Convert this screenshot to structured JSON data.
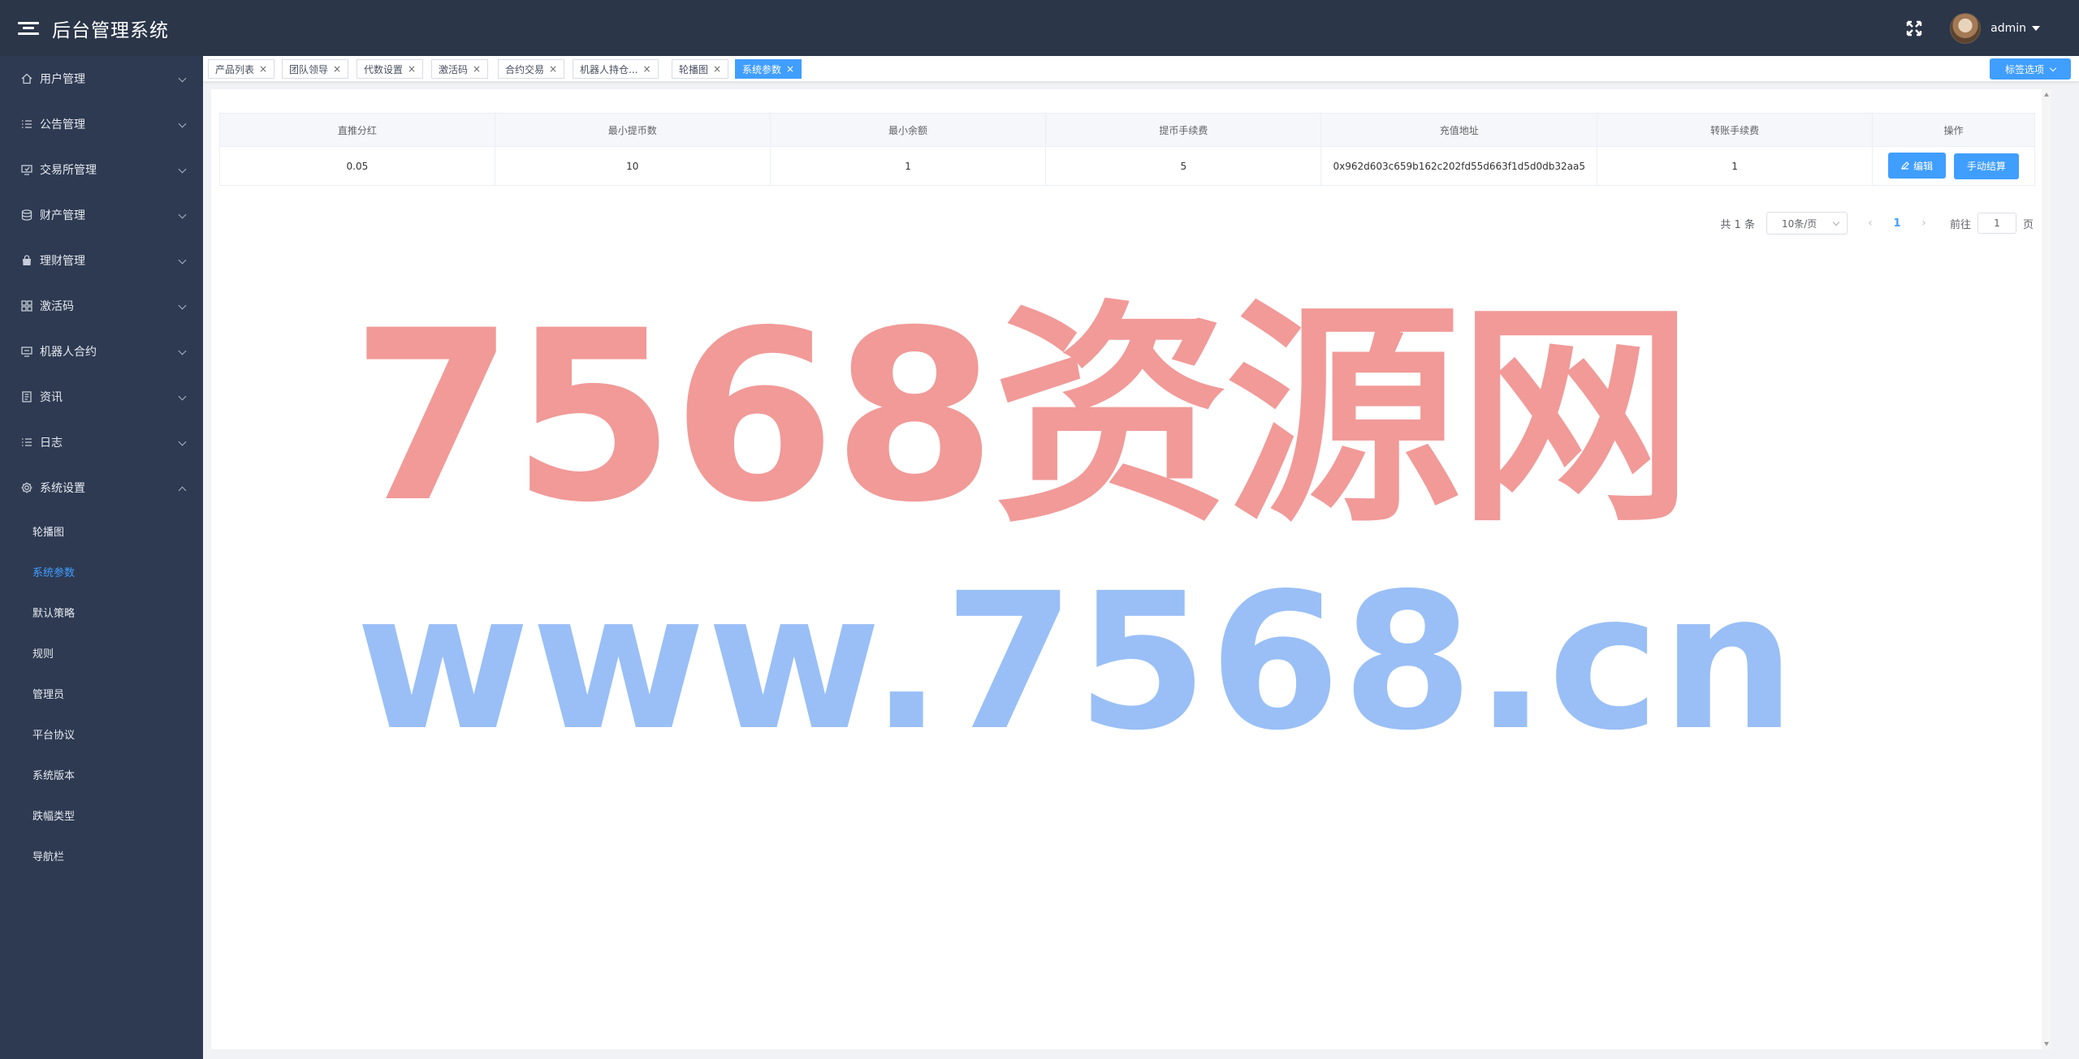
{
  "header": {
    "app_title": "后台管理系统",
    "username": "admin",
    "icons": [
      "menu-toggle-icon",
      "fullscreen-icon",
      "avatar"
    ]
  },
  "sidebar": {
    "items": [
      {
        "label": "用户管理",
        "icon": "home-icon"
      },
      {
        "label": "公告管理",
        "icon": "list-icon"
      },
      {
        "label": "交易所管理",
        "icon": "cart-icon"
      },
      {
        "label": "财产管理",
        "icon": "coins-icon"
      },
      {
        "label": "理财管理",
        "icon": "bag-icon"
      },
      {
        "label": "激活码",
        "icon": "grid-icon"
      },
      {
        "label": "机器人合约",
        "icon": "robot-cart-icon"
      },
      {
        "label": "资讯",
        "icon": "document-icon"
      },
      {
        "label": "日志",
        "icon": "list-icon"
      },
      {
        "label": "系统设置",
        "icon": "gear-icon",
        "expanded": true
      }
    ],
    "sub_items": [
      {
        "label": "轮播图"
      },
      {
        "label": "系统参数",
        "active": true
      },
      {
        "label": "默认策略"
      },
      {
        "label": "规则"
      },
      {
        "label": "管理员"
      },
      {
        "label": "平台协议"
      },
      {
        "label": "系统版本"
      },
      {
        "label": "跌幅类型"
      },
      {
        "label": "导航栏"
      }
    ]
  },
  "tabs": {
    "items": [
      {
        "label": "产品列表"
      },
      {
        "label": "团队领导"
      },
      {
        "label": "代数设置"
      },
      {
        "label": "激活码"
      },
      {
        "label": "合约交易"
      },
      {
        "label": "机器人持仓..."
      },
      {
        "label": "轮播图"
      },
      {
        "label": "系统参数",
        "active": true
      }
    ],
    "close_glyph": "×",
    "options_label": "标签选项"
  },
  "table": {
    "columns": [
      "直推分红",
      "最小提币数",
      "最小余额",
      "提币手续费",
      "充值地址",
      "转账手续费",
      "操作"
    ],
    "rows": [
      [
        "0.05",
        "10",
        "1",
        "5",
        "0x962d603c659b162c202fd55d663f1d5d0db32aa5",
        "1"
      ]
    ],
    "actions": {
      "edit_label": "编辑",
      "settle_label": "手动结算"
    }
  },
  "pagination": {
    "total_text": "共 1 条",
    "page_size": "10条/页",
    "current_page": "1",
    "goto_label": "前往",
    "goto_value": "1",
    "page_suffix": "页"
  },
  "watermark": {
    "line1": "7568资源网",
    "line2": "www.7568.cn"
  },
  "colors": {
    "header_bg": "#2b3649",
    "sidebar_bg": "#2e3a52",
    "accent": "#409eff"
  }
}
